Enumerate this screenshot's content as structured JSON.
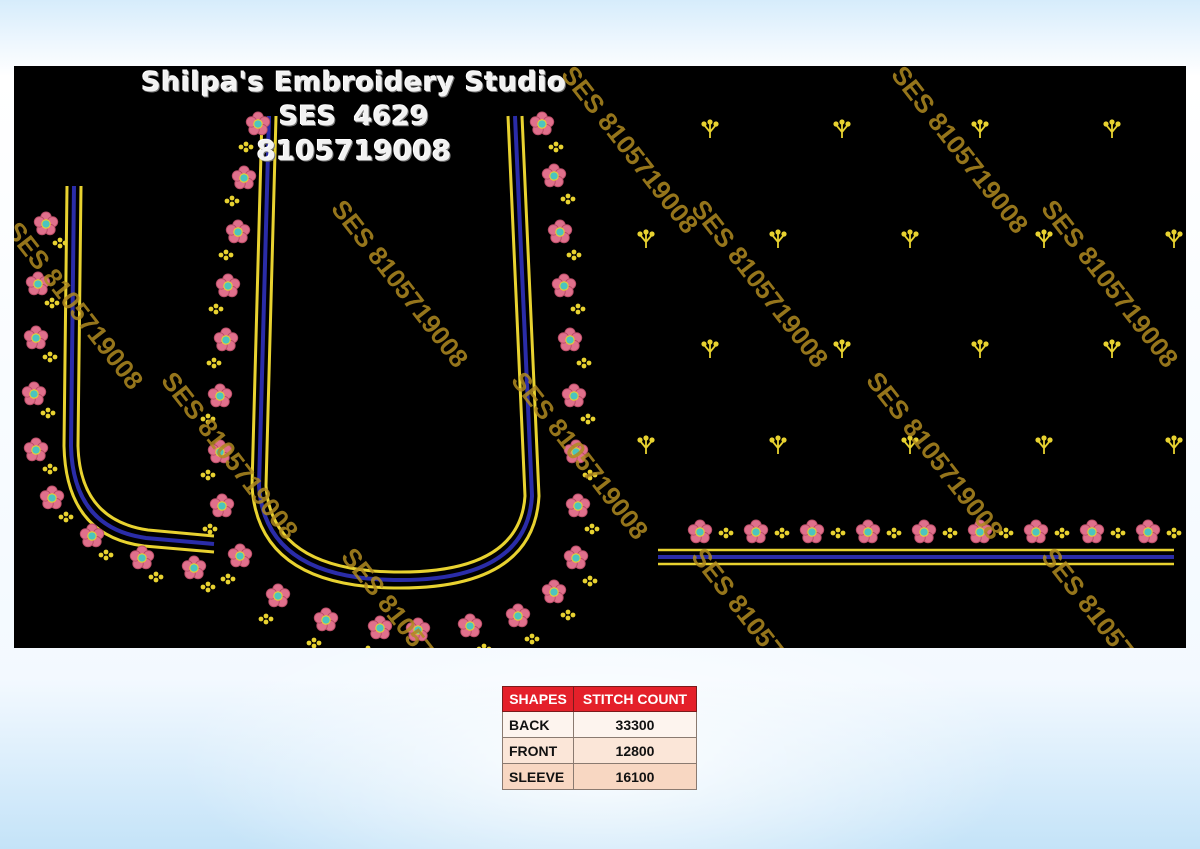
{
  "studio": {
    "name": "Shilpa's Embroidery Studio",
    "design_code": "SES 4629",
    "phone": "8105719008"
  },
  "watermark": "SES 8105719008",
  "stitch_table": {
    "headers": [
      "SHAPES",
      "STITCH COUNT"
    ],
    "rows": [
      {
        "shape": "BACK",
        "count": "33300"
      },
      {
        "shape": "FRONT",
        "count": "12800"
      },
      {
        "shape": "SLEEVE",
        "count": "16100"
      }
    ]
  },
  "colors": {
    "background": "#000000",
    "gold_thread": "#e8d230",
    "blue_thread": "#2a2ca8",
    "pink_petal": "#e0708c",
    "flower_center": "#4cc4c0",
    "header_red": "#e4202a"
  }
}
